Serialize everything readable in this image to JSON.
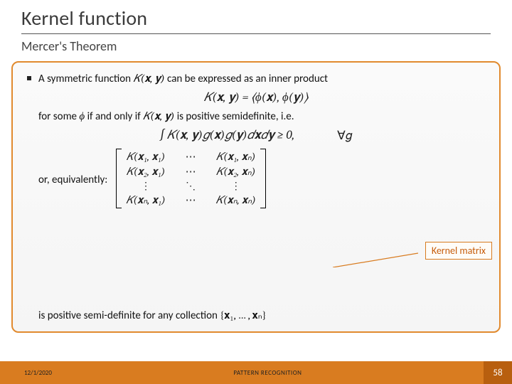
{
  "title": "Kernel function",
  "subtitle": "Mercer's Theorem",
  "body": {
    "line1a": "A symmetric function ",
    "line1b": " can be expressed as an inner product",
    "forsome_a": "for some ",
    "forsome_b": " if and only if ",
    "forsome_c": " is positive semidefinite, i.e.",
    "or_equiv": "or, equivalently:",
    "psd_a": "is positive semi-definite for any collection ",
    "forall": "∀𝑔"
  },
  "math": {
    "Kxy": "𝐾(𝐱, 𝐲)",
    "eq1": "𝐾(𝐱, 𝐲) = ⟨ϕ(𝐱), ϕ(𝐲)⟩",
    "phi": "ϕ",
    "integral": "∫ 𝐾(𝐱, 𝐲)𝑔(𝐱)𝑔(𝐲)𝑑𝐱𝑑𝐲 ≥ 0,",
    "matrix": {
      "r1c1": "𝐾(𝐱₁, 𝐱₁)",
      "r1c2": "⋯",
      "r1c3": "𝐾(𝐱₁, 𝐱ₙ)",
      "r2c1": "𝐾(𝐱₂, 𝐱₁)",
      "r2c2": "⋯",
      "r2c3": "𝐾(𝐱₂, 𝐱ₙ)",
      "r3c1": "⋮",
      "r3c2": "⋱",
      "r3c3": "⋮",
      "r4c1": "𝐾(𝐱ₙ, 𝐱₁)",
      "r4c2": "⋯",
      "r4c3": "𝐾(𝐱ₙ, 𝐱ₙ)"
    },
    "collection": "{𝐱₁, … , 𝐱ₙ}"
  },
  "callout": "Kernel matrix",
  "footer": {
    "date": "12/1/2020",
    "center": "PATTERN RECOGNITION",
    "page": "58"
  }
}
